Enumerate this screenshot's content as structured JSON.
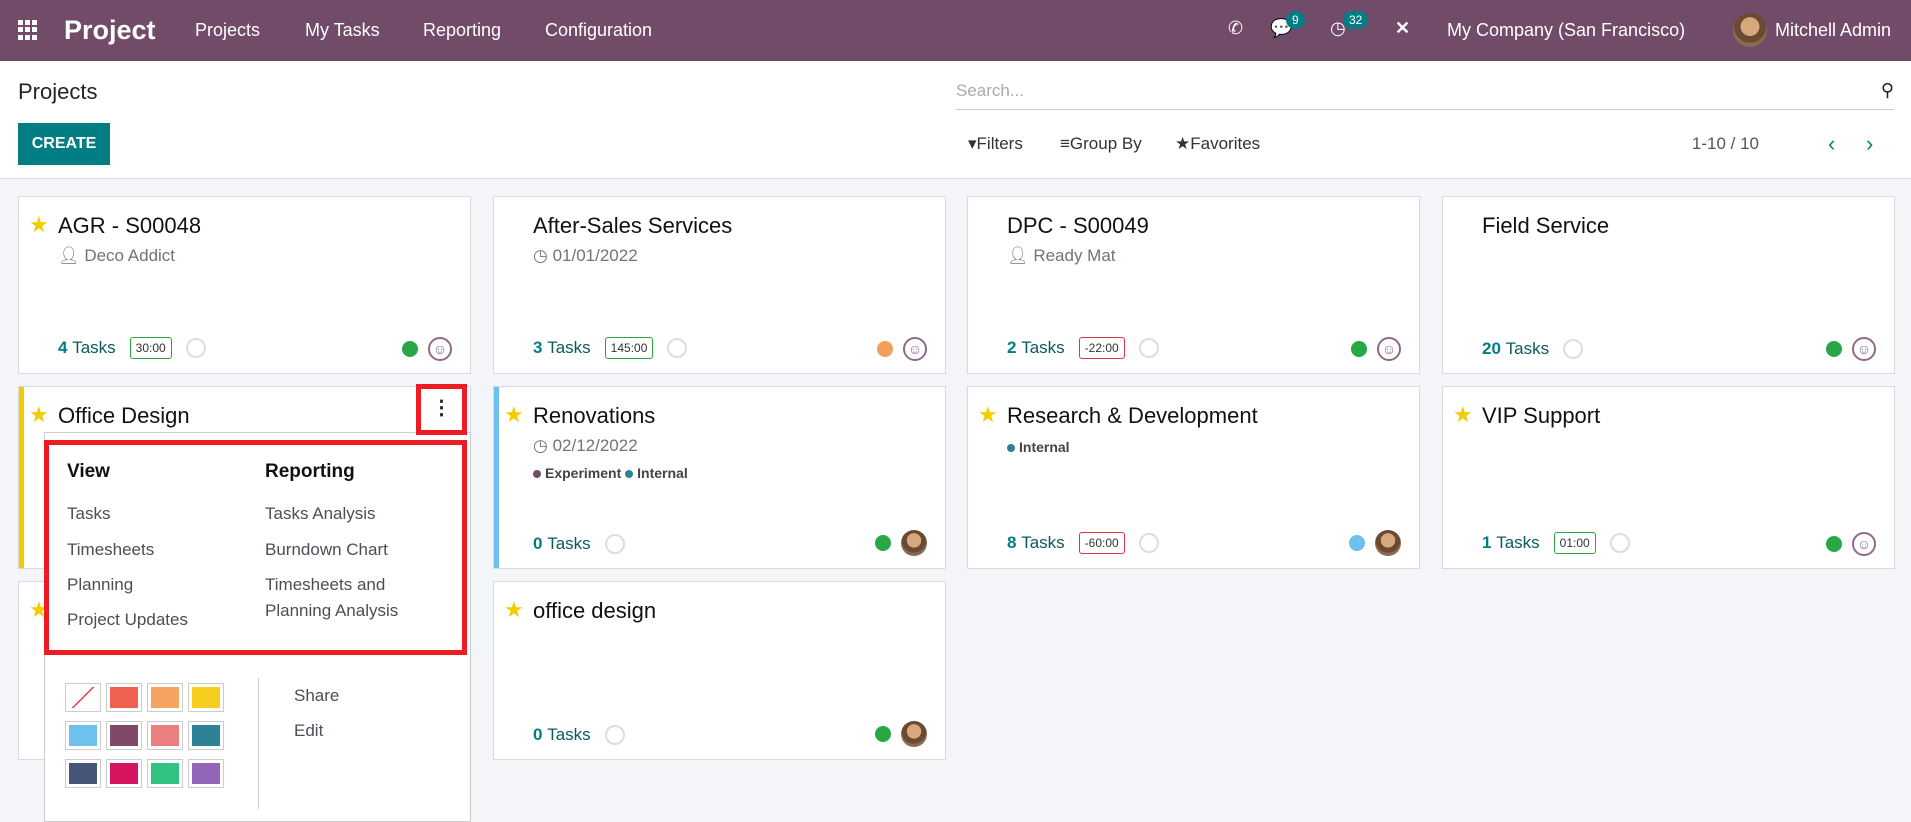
{
  "navbar": {
    "app_name": "Project",
    "menu": [
      "Projects",
      "My Tasks",
      "Reporting",
      "Configuration"
    ],
    "messages_count": "9",
    "activities_count": "32",
    "company": "My Company (San Francisco)",
    "user": "Mitchell Admin"
  },
  "control_panel": {
    "title": "Projects",
    "create_label": "CREATE",
    "search_placeholder": "Search...",
    "filters_label": "Filters",
    "group_by_label": "Group By",
    "favorites_label": "Favorites",
    "pager": "1-10 / 10"
  },
  "projects": [
    {
      "name": "AGR - S00048",
      "favorite": true,
      "customer": "Deco Addict",
      "tasks_count": "4",
      "tasks_label": "Tasks",
      "hours": "30:00",
      "hours_status": "positive",
      "status_color": "#28a745",
      "assignee": "smiley"
    },
    {
      "name": "After-Sales Services",
      "favorite": false,
      "date": "01/01/2022",
      "tasks_count": "3",
      "tasks_label": "Tasks",
      "hours": "145:00",
      "hours_status": "positive",
      "status_color": "#f0a05a",
      "assignee": "smiley"
    },
    {
      "name": "DPC - S00049",
      "favorite": false,
      "customer": "Ready Mat",
      "tasks_count": "2",
      "tasks_label": "Tasks",
      "hours": "-22:00",
      "hours_status": "negative",
      "status_color": "#28a745",
      "assignee": "smiley"
    },
    {
      "name": "Field Service",
      "favorite": false,
      "tasks_count": "20",
      "tasks_label": "Tasks",
      "status_color": "#28a745",
      "assignee": "smiley"
    },
    {
      "name": "Office Design",
      "favorite": true,
      "color": "#f3cc00"
    },
    {
      "name": "Renovations",
      "favorite": true,
      "date": "02/12/2022",
      "tags": [
        {
          "label": "Experiment",
          "color": "#714b67"
        },
        {
          "label": "Internal",
          "color": "#2c8397"
        }
      ],
      "tasks_count": "0",
      "tasks_label": "Tasks",
      "status_color": "#28a745",
      "assignee": "photo",
      "color": "#6cc1ed"
    },
    {
      "name": "Research & Development",
      "favorite": true,
      "tags": [
        {
          "label": "Internal",
          "color": "#2c8397"
        }
      ],
      "tasks_count": "8",
      "tasks_label": "Tasks",
      "hours": "-60:00",
      "hours_status": "negative",
      "status_color": "#6cc1ed",
      "assignee": "photo"
    },
    {
      "name": "VIP Support",
      "favorite": true,
      "tasks_count": "1",
      "tasks_label": "Tasks",
      "hours": "01:00",
      "hours_status": "positive",
      "status_color": "#28a745",
      "assignee": "smiley"
    },
    {
      "name": "office design",
      "favorite": true,
      "tasks_count": "0",
      "tasks_label": "Tasks",
      "status_color": "#28a745",
      "assignee": "photo"
    }
  ],
  "dropdown": {
    "view_header": "View",
    "view_items": [
      "Tasks",
      "Timesheets",
      "Planning",
      "Project Updates"
    ],
    "reporting_header": "Reporting",
    "reporting_items": [
      "Tasks Analysis",
      "Burndown Chart",
      "Timesheets and Planning Analysis"
    ],
    "colors": [
      "none",
      "#f06050",
      "#f4a460",
      "#f7cd1f",
      "#6cc1ed",
      "#814968",
      "#eb7e7f",
      "#2c8397",
      "#475577",
      "#d6145f",
      "#30c381",
      "#9365b8"
    ],
    "actions": [
      "Share",
      "Edit"
    ]
  }
}
